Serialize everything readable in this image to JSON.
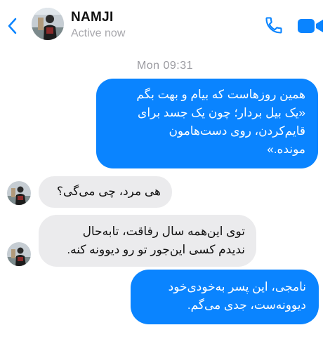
{
  "header": {
    "contact_name": "NAMJI",
    "status": "Active now",
    "back_icon": "chevron-left-icon",
    "call_icon": "phone-icon",
    "video_icon": "video-camera-icon"
  },
  "conversation": {
    "timestamp": "Mon 09:31",
    "messages": [
      {
        "direction": "outgoing",
        "text": "همین روزهاست که بیام و بهت بگم\n«یک بیل بردار؛ چون یک جسد برای\nقایم‌کردن، روی دست‌هامون\nمونده.»"
      },
      {
        "direction": "incoming",
        "text": "هی مرد، چی می‌گی؟"
      },
      {
        "direction": "incoming",
        "text": "توی این‌همه سال رفاقت، تابه‌حال\nندیدم کسی این‌جور تو رو دیوونه کنه."
      },
      {
        "direction": "outgoing",
        "text": "نامجی، این پسر به‌خودی‌خود\nدیوونه‌ست، جدی می‌گم."
      }
    ]
  },
  "colors": {
    "accent": "#0a84ff",
    "outgoing_bubble": "#0a84ff",
    "incoming_bubble": "#ebebed",
    "status_text": "#a7a7ac"
  }
}
